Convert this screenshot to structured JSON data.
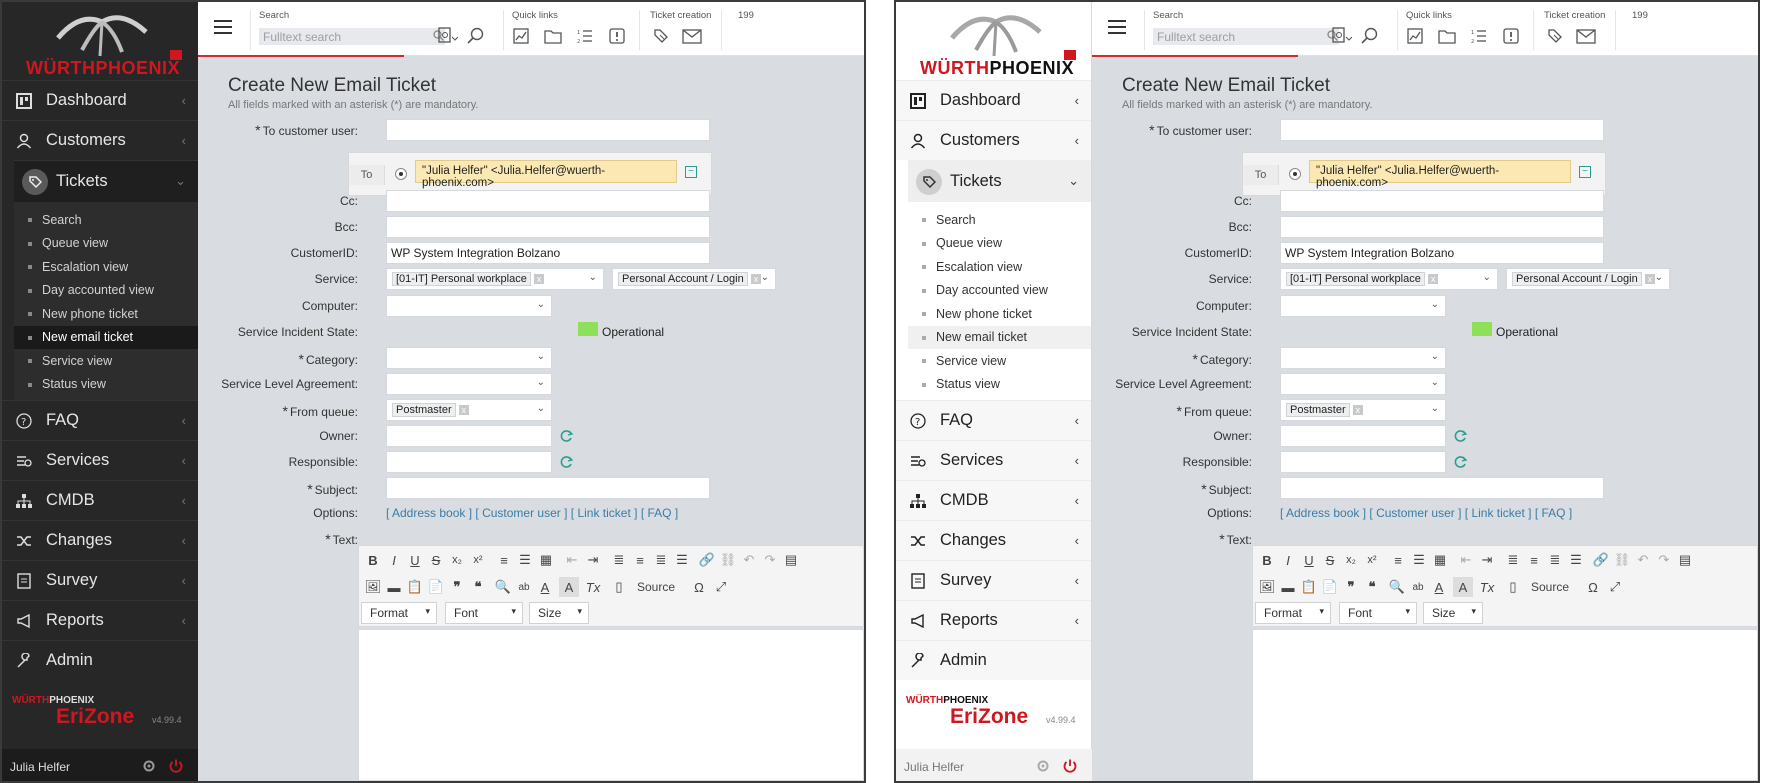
{
  "brand": {
    "logo_wurth": "WÜRTH",
    "logo_phoenix": "PHOENIX",
    "product": "EriZone",
    "version": "v4.99.4"
  },
  "nav": {
    "dashboard": "Dashboard",
    "customers": "Customers",
    "tickets": "Tickets",
    "tickets_sub": [
      "Search",
      "Queue view",
      "Escalation view",
      "Day accounted view",
      "New phone ticket",
      "New email ticket",
      "Service view",
      "Status view"
    ],
    "faq": "FAQ",
    "services": "Services",
    "cmdb": "CMDB",
    "changes": "Changes",
    "survey": "Survey",
    "reports": "Reports",
    "admin": "Admin"
  },
  "user": {
    "name": "Julia Helfer"
  },
  "header": {
    "search_label": "Search",
    "search_placeholder": "Fulltext search",
    "quick_links_label": "Quick links",
    "ticket_creation_label": "Ticket creation",
    "count": "199"
  },
  "form": {
    "title": "Create New Email Ticket",
    "subtitle": "All fields marked with an asterisk (*) are mandatory.",
    "labels": {
      "to_customer_user": "To customer user:",
      "to": "To",
      "cc": "Cc:",
      "bcc": "Bcc:",
      "customer_id": "CustomerID:",
      "service": "Service:",
      "computer": "Computer:",
      "service_incident_state": "Service Incident State:",
      "category": "Category:",
      "sla": "Service Level Agreement:",
      "from_queue": "From queue:",
      "owner": "Owner:",
      "responsible": "Responsible:",
      "subject": "Subject:",
      "options": "Options:",
      "text": "Text:"
    },
    "asterisk": "*",
    "to_email": "\"Julia Helfer\" <Julia.Helfer@wuerth-phoenix.com>",
    "customer_id_value": "WP System Integration Bolzano",
    "service_value": "[01-IT] Personal workplace",
    "service_sub_value": "Personal Account / Login",
    "chip_remove": "x",
    "incident_state": "Operational",
    "incident_state_color": "#8ee05a",
    "from_queue_value": "Postmaster",
    "options_links": [
      "[ Address book ]",
      "[ Customer user ]",
      "[ Link ticket ]",
      "[ FAQ ]"
    ],
    "editor": {
      "source_label": "Source",
      "format_label": "Format",
      "font_label": "Font",
      "size_label": "Size"
    }
  }
}
